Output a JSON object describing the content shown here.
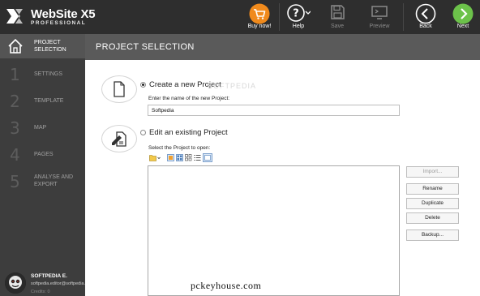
{
  "app": {
    "title": "WebSite X5",
    "edition": "PROFESSIONAL"
  },
  "toolbar": {
    "buy_label": "Buy now!",
    "help_label": "Help",
    "save_label": "Save",
    "preview_label": "Preview",
    "back_label": "Back",
    "next_label": "Next"
  },
  "colors": {
    "buy_accent": "#f08a1c",
    "next_accent": "#6cc24a",
    "sidebar_bg": "#3d3d3d",
    "header_bg": "#5a5a5a"
  },
  "sidebar": {
    "home_label_line1": "PROJECT",
    "home_label_line2": "SELECTION",
    "items": [
      {
        "num": "1",
        "label": "SETTINGS"
      },
      {
        "num": "2",
        "label": "TEMPLATE"
      },
      {
        "num": "3",
        "label": "MAP"
      },
      {
        "num": "4",
        "label": "PAGES"
      },
      {
        "num": "5",
        "label_line1": "ANALYSE AND",
        "label_line2": "EXPORT"
      }
    ]
  },
  "user": {
    "name": "SOFTPEDIA E.",
    "email": "softpedia.editor@softpedia.co...",
    "credits": "Credits: 0"
  },
  "page": {
    "title": "PROJECT SELECTION"
  },
  "create": {
    "label": "Create a new Project",
    "field_label": "Enter the name of the new Project:",
    "value": "Softpedia"
  },
  "edit": {
    "label": "Edit an existing Project",
    "field_label": "Select the Project to open:"
  },
  "project_buttons": {
    "import": "Import...",
    "rename": "Rename",
    "duplicate": "Duplicate",
    "delete": "Delete",
    "backup": "Backup..."
  },
  "watermark": "pckeyhouse.com",
  "ghost_watermark": "SOFTPEDIA"
}
